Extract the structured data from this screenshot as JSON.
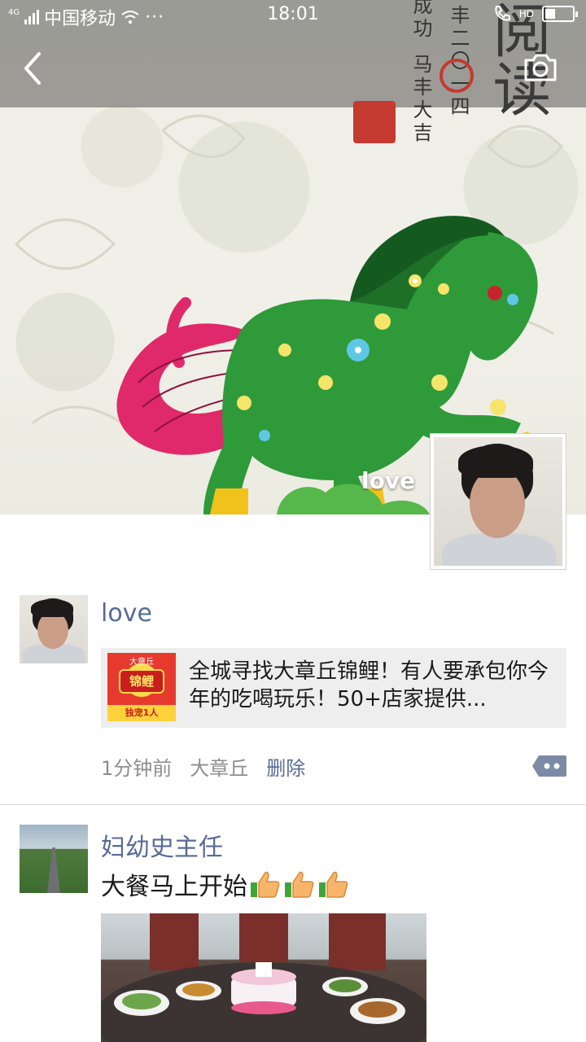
{
  "status_bar": {
    "network_type": "4G",
    "carrier": "中国移动",
    "more": "···",
    "time": "18:01",
    "hd": "HD"
  },
  "nav": {
    "back_icon": "chevron-left-icon",
    "camera_icon": "camera-icon"
  },
  "cover": {
    "calligraphy_big": "阅读",
    "calligraphy_col1": "丰二〇一四",
    "calligraphy_col2": "马丰大吉",
    "calligraphy_col3": "成功",
    "display_name": "love"
  },
  "posts": [
    {
      "author": "love",
      "share": {
        "thumb_top": "大章丘",
        "thumb_title": "锦鲤",
        "thumb_bottom": "独宠1人",
        "text": "全城寻找大章丘锦鲤！有人要承包你今年的吃喝玩乐！50+店家提供..."
      },
      "time": "1分钟前",
      "location": "大章丘",
      "delete_label": "删除",
      "comment_icon": "more-dots-icon"
    },
    {
      "author": "妇幼史主任",
      "text": "大餐马上开始",
      "emoji": "thumbs-up-icon"
    }
  ],
  "colors": {
    "link": "#576b95",
    "horse_green": "#2f9a3a",
    "tail_pink": "#e0296a"
  }
}
